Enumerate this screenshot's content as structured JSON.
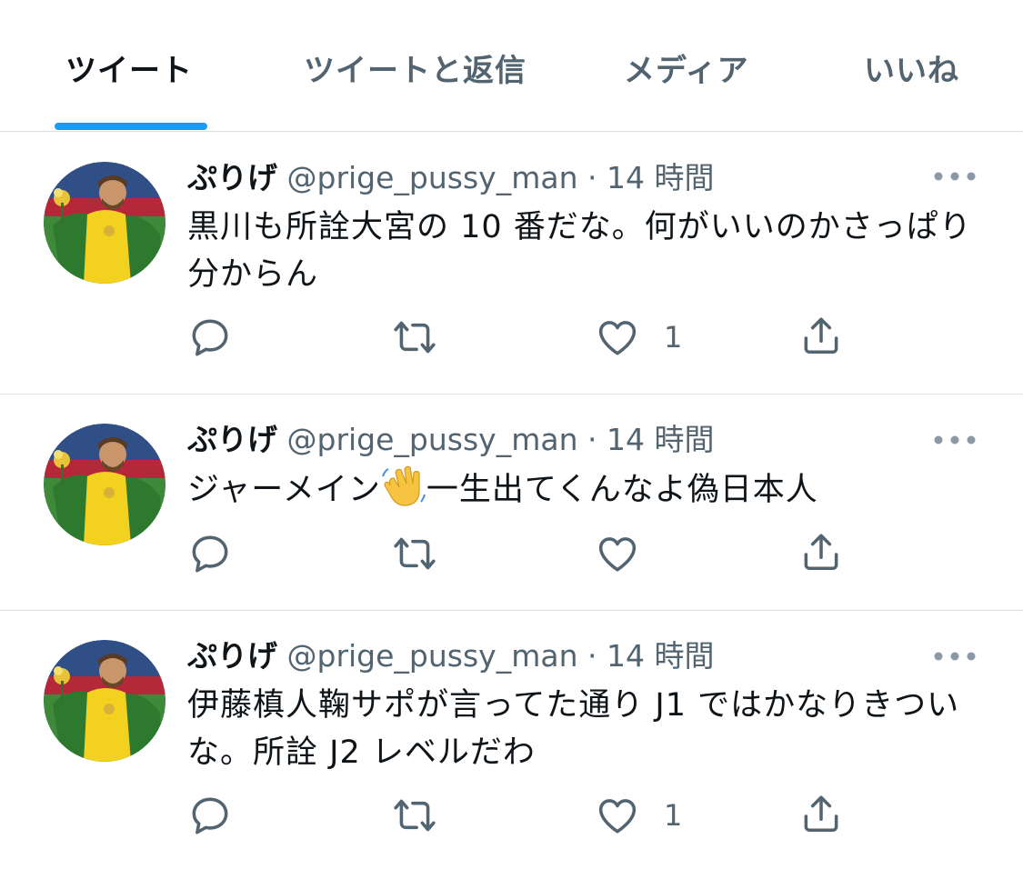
{
  "tabs": {
    "tweets": "ツイート",
    "tweets_replies": "ツイートと返信",
    "media": "メディア",
    "likes": "いいね"
  },
  "tweets": [
    {
      "display_name": "ぷりげ",
      "handle": "@prige_pussy_man",
      "separator": "·",
      "time": "14 時間",
      "text": "黒川も所詮大宮の 10 番だな。何がいいのかさっぱり分からん",
      "likes": "1"
    },
    {
      "display_name": "ぷりげ",
      "handle": "@prige_pussy_man",
      "separator": "·",
      "time": "14 時間",
      "text_before": "ジャーメイン",
      "text_after": "一生出てくんなよ偽日本人",
      "likes": ""
    },
    {
      "display_name": "ぷりげ",
      "handle": "@prige_pussy_man",
      "separator": "·",
      "time": "14 時間",
      "text": "伊藤槙人鞠サポが言ってた通り J1 ではかなりきついな。所詮 J2 レベルだわ",
      "likes": "1"
    }
  ],
  "icons": {
    "reply": "reply-icon",
    "retweet": "retweet-icon",
    "like": "heart-icon",
    "share": "share-icon",
    "more": "more-icon",
    "emoji": "waving-hand-emoji"
  },
  "colors": {
    "accent": "#1d9bf0",
    "text": "#0f1419",
    "secondary": "#536471"
  }
}
